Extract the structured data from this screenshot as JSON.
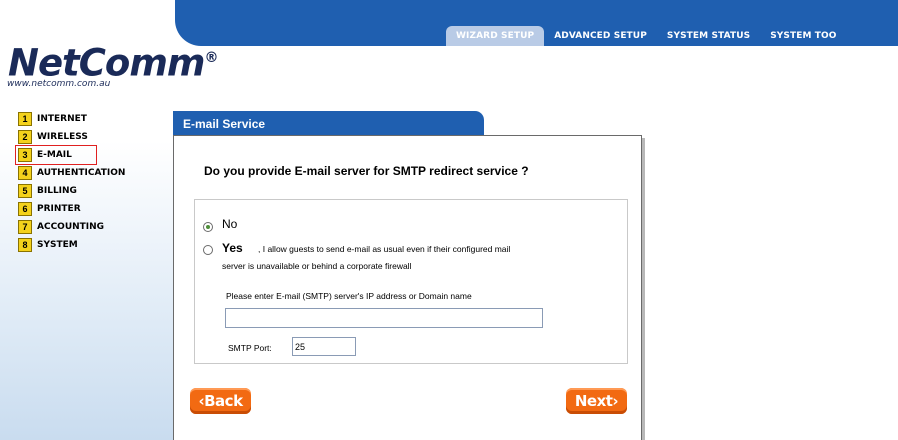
{
  "header": {
    "tabs": [
      {
        "label": "WIZARD SETUP",
        "active": true
      },
      {
        "label": "ADVANCED SETUP",
        "active": false
      },
      {
        "label": "SYSTEM STATUS",
        "active": false
      },
      {
        "label": "SYSTEM TOO",
        "active": false
      }
    ]
  },
  "brand": {
    "logo_text": "NetComm",
    "trademark": "®",
    "url": "www.netcomm.com.au"
  },
  "sidebar": {
    "steps": [
      {
        "num": "1",
        "label": "INTERNET"
      },
      {
        "num": "2",
        "label": "WIRELESS"
      },
      {
        "num": "3",
        "label": "E-MAIL",
        "active": true
      },
      {
        "num": "4",
        "label": "AUTHENTICATION"
      },
      {
        "num": "5",
        "label": "BILLING"
      },
      {
        "num": "6",
        "label": "PRINTER"
      },
      {
        "num": "7",
        "label": "ACCOUNTING"
      },
      {
        "num": "8",
        "label": "SYSTEM"
      }
    ]
  },
  "panel": {
    "title": "E-mail Service",
    "question": "Do you provide E-mail server for SMTP redirect service ?",
    "options": {
      "no_label": "No",
      "yes_label": "Yes",
      "yes_desc_line1": ", I allow guests to send e-mail as usual even if their configured mail",
      "yes_desc_line2": "server is unavailable or behind a corporate firewall",
      "selected": "No"
    },
    "server_label": "Please enter E-mail (SMTP) server's IP address or Domain name",
    "server_value": "",
    "port_label": "SMTP Port:",
    "port_value": "25"
  },
  "buttons": {
    "back": "‹Back",
    "next": "Next›"
  },
  "colors": {
    "header_blue": "#1f5fb0",
    "button_orange": "#f26a12",
    "step_yellow": "#f4d21c",
    "active_outline": "#e02020"
  }
}
